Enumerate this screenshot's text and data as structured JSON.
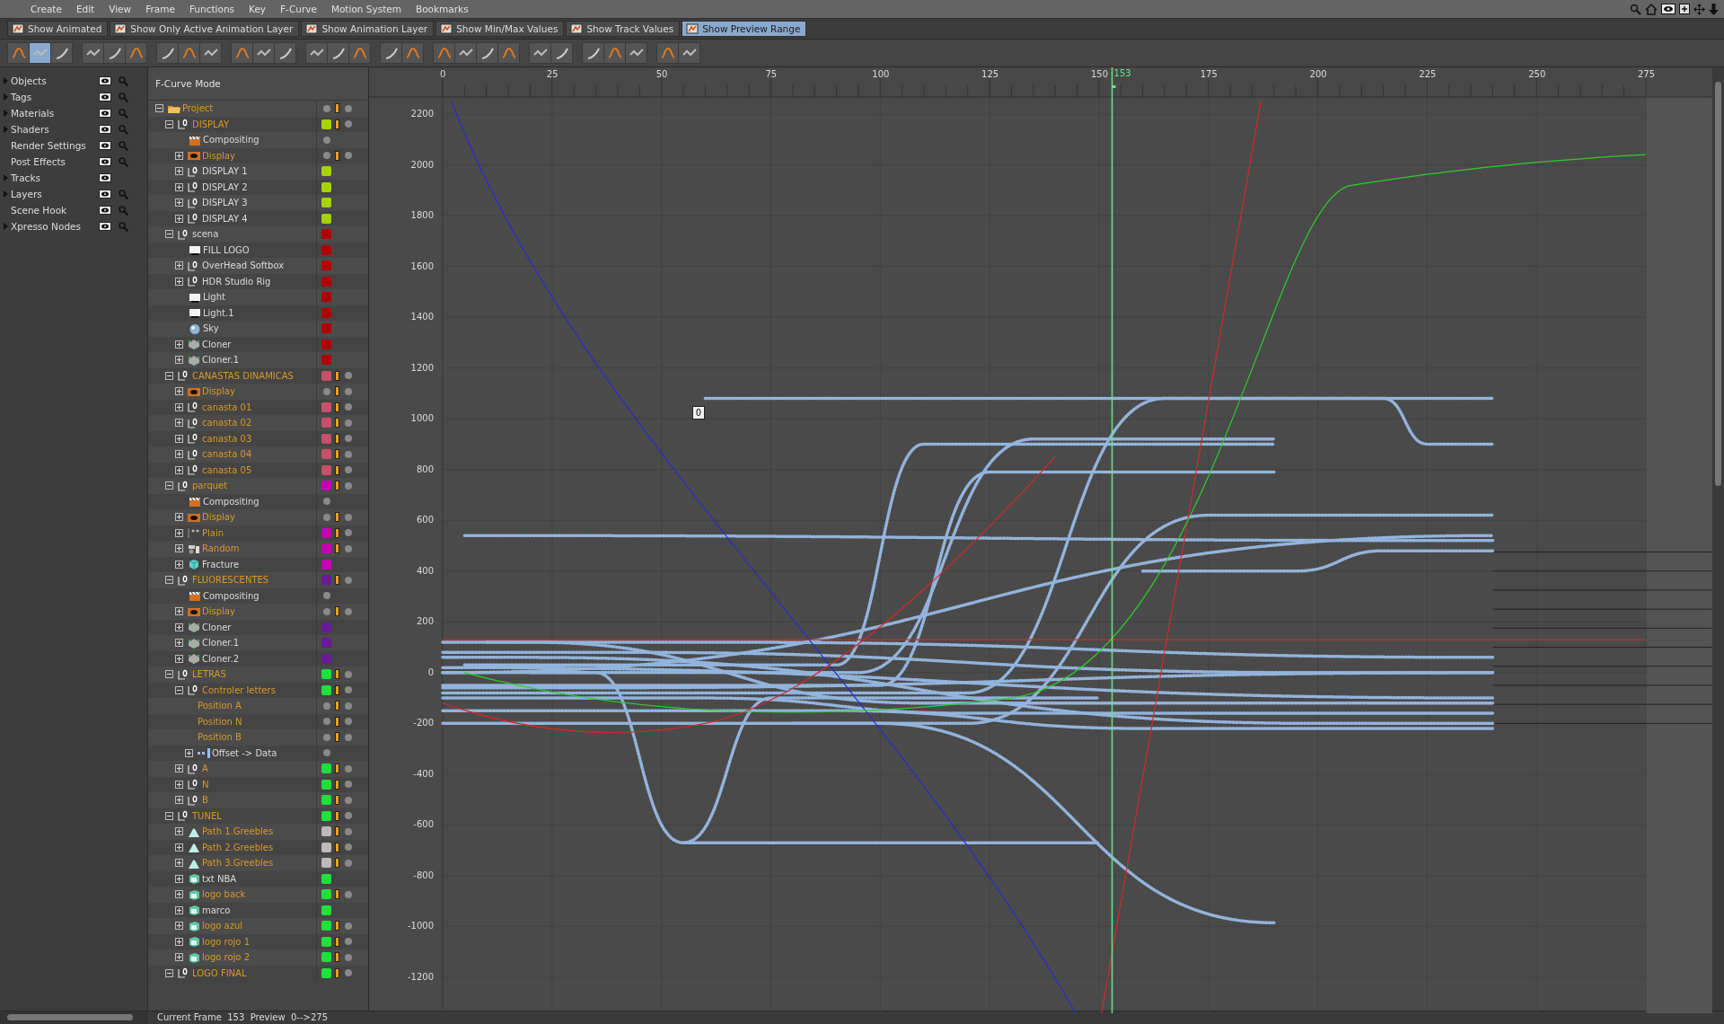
{
  "menu": [
    "Create",
    "Edit",
    "View",
    "Frame",
    "Functions",
    "Key",
    "F-Curve",
    "Motion System",
    "Bookmarks"
  ],
  "filters": [
    {
      "label": "Show Animated",
      "selected": false
    },
    {
      "label": "Show Only Active Animation Layer",
      "selected": false
    },
    {
      "label": "Show Animation Layer",
      "selected": false
    },
    {
      "label": "Show Min/Max Values",
      "selected": false
    },
    {
      "label": "Show Track Values",
      "selected": false
    },
    {
      "label": "Show Preview Range",
      "selected": true
    }
  ],
  "toolbar": [
    {
      "buttons": [
        {
          "selected": false
        },
        {
          "selected": true
        },
        {
          "selected": false
        }
      ]
    },
    {
      "buttons": [
        {
          "selected": false
        },
        {
          "selected": false
        },
        {
          "selected": false
        }
      ]
    },
    {
      "buttons": [
        {
          "selected": false
        },
        {
          "selected": false
        },
        {
          "selected": false
        }
      ]
    },
    {
      "buttons": [
        {
          "selected": false
        },
        {
          "selected": false
        },
        {
          "selected": false
        }
      ]
    },
    {
      "buttons": [
        {
          "selected": false
        },
        {
          "selected": false
        },
        {
          "selected": false
        }
      ]
    },
    {
      "buttons": [
        {
          "selected": false
        },
        {
          "selected": false
        }
      ]
    },
    {
      "buttons": [
        {
          "selected": false
        },
        {
          "selected": false
        },
        {
          "selected": false
        },
        {
          "selected": false
        }
      ]
    },
    {
      "buttons": [
        {
          "selected": false
        },
        {
          "selected": false
        }
      ]
    },
    {
      "buttons": [
        {
          "selected": false
        },
        {
          "selected": false
        },
        {
          "selected": false
        }
      ]
    },
    {
      "buttons": [
        {
          "selected": false
        },
        {
          "selected": false
        }
      ]
    }
  ],
  "sidebar": [
    {
      "label": "Objects",
      "expandable": true,
      "search": true
    },
    {
      "label": "Tags",
      "expandable": true,
      "search": true
    },
    {
      "label": "Materials",
      "expandable": true,
      "search": true
    },
    {
      "label": "Shaders",
      "expandable": true,
      "search": true
    },
    {
      "label": "Render Settings",
      "expandable": false,
      "search": true
    },
    {
      "label": "Post Effects",
      "expandable": false,
      "search": true
    },
    {
      "label": "Tracks",
      "expandable": true,
      "search": false
    },
    {
      "label": "Layers",
      "expandable": true,
      "search": true
    },
    {
      "label": "Scene Hook",
      "expandable": false,
      "search": true
    },
    {
      "label": "Xpresso Nodes",
      "expandable": true,
      "search": true
    }
  ],
  "tree_header": "F-Curve Mode",
  "tree": [
    {
      "label": "Project",
      "kind": "folder",
      "animated": true,
      "expanded": true,
      "children": [
        {
          "label": "DISPLAY",
          "kind": "null",
          "animated": true,
          "color": "#a8d400",
          "expanded": true,
          "children": [
            {
              "label": "Compositing",
              "kind": "compositing",
              "animated": false
            },
            {
              "label": "Display",
              "kind": "display",
              "animated": true,
              "expanded": false
            },
            {
              "label": "DISPLAY 1",
              "kind": "null",
              "animated": false,
              "color": "#a8d400",
              "expanded": false
            },
            {
              "label": "DISPLAY 2",
              "kind": "null",
              "animated": false,
              "color": "#a8d400",
              "expanded": false
            },
            {
              "label": "DISPLAY 3",
              "kind": "null",
              "animated": false,
              "color": "#a8d400",
              "expanded": false
            },
            {
              "label": "DISPLAY 4",
              "kind": "null",
              "animated": false,
              "color": "#a8d400",
              "expanded": false
            }
          ]
        },
        {
          "label": "scena",
          "kind": "null",
          "animated": false,
          "color": "#b00000",
          "expanded": true,
          "children": [
            {
              "label": "FILL LOGO",
              "kind": "light",
              "animated": false,
              "color": "#b00000"
            },
            {
              "label": "OverHead Softbox",
              "kind": "null",
              "animated": false,
              "color": "#b00000",
              "expanded": false
            },
            {
              "label": "HDR Studio Rig",
              "kind": "null",
              "animated": false,
              "color": "#b00000",
              "expanded": false
            },
            {
              "label": "Light",
              "kind": "light",
              "animated": false,
              "color": "#b00000"
            },
            {
              "label": "Light.1",
              "kind": "light",
              "animated": false,
              "color": "#b00000"
            },
            {
              "label": "Sky",
              "kind": "sky",
              "animated": false,
              "color": "#b00000"
            },
            {
              "label": "Cloner",
              "kind": "cloner",
              "animated": false,
              "color": "#b00000",
              "expanded": false
            },
            {
              "label": "Cloner.1",
              "kind": "cloner",
              "animated": false,
              "color": "#b00000",
              "expanded": false
            }
          ]
        },
        {
          "label": "CANASTAS DINAMICAS",
          "kind": "null",
          "animated": true,
          "color": "#c8506a",
          "expanded": true,
          "children": [
            {
              "label": "Display",
              "kind": "display",
              "animated": true,
              "expanded": false
            },
            {
              "label": "canasta 01",
              "kind": "null",
              "animated": true,
              "color": "#c8506a",
              "expanded": false
            },
            {
              "label": "canasta 02",
              "kind": "null",
              "animated": true,
              "color": "#c8506a",
              "expanded": false
            },
            {
              "label": "canasta 03",
              "kind": "null",
              "animated": true,
              "color": "#c8506a",
              "expanded": false
            },
            {
              "label": "canasta 04",
              "kind": "null",
              "animated": true,
              "color": "#c8506a",
              "expanded": false
            },
            {
              "label": "canasta 05",
              "kind": "null",
              "animated": true,
              "color": "#c8506a",
              "expanded": false
            }
          ]
        },
        {
          "label": "parquet",
          "kind": "null",
          "animated": true,
          "color": "#c800b4",
          "expanded": true,
          "children": [
            {
              "label": "Compositing",
              "kind": "compositing",
              "animated": false
            },
            {
              "label": "Display",
              "kind": "display",
              "animated": true,
              "expanded": false
            },
            {
              "label": "Plain",
              "kind": "plain",
              "animated": true,
              "color": "#c800b4",
              "expanded": false
            },
            {
              "label": "Random",
              "kind": "random",
              "animated": true,
              "color": "#c800b4",
              "expanded": false
            },
            {
              "label": "Fracture",
              "kind": "fracture",
              "animated": false,
              "color": "#c800b4",
              "expanded": false
            }
          ]
        },
        {
          "label": "FLUORESCENTES",
          "kind": "null",
          "animated": true,
          "color": "#6a1a9a",
          "expanded": true,
          "children": [
            {
              "label": "Compositing",
              "kind": "compositing",
              "animated": false
            },
            {
              "label": "Display",
              "kind": "display",
              "animated": true,
              "expanded": false
            },
            {
              "label": "Cloner",
              "kind": "cloner",
              "animated": false,
              "color": "#6a1a9a",
              "expanded": false
            },
            {
              "label": "Cloner.1",
              "kind": "cloner",
              "animated": false,
              "color": "#6a1a9a",
              "expanded": false
            },
            {
              "label": "Cloner.2",
              "kind": "cloner",
              "animated": false,
              "color": "#6a1a9a",
              "expanded": false
            }
          ]
        },
        {
          "label": "LETRAS",
          "kind": "null",
          "animated": true,
          "color": "#1ee23c",
          "expanded": true,
          "children": [
            {
              "label": "Controler letters",
              "kind": "null",
              "animated": true,
              "color": "#1ee23c",
              "expanded": true,
              "children": [
                {
                  "label": "Position A",
                  "kind": "track",
                  "animated": true
                },
                {
                  "label": "Position N",
                  "kind": "track",
                  "animated": true
                },
                {
                  "label": "Position B",
                  "kind": "track",
                  "animated": true
                },
                {
                  "label": "Offset -> Data",
                  "kind": "xpresso",
                  "animated": false,
                  "expanded": false
                }
              ]
            },
            {
              "label": "A",
              "kind": "null",
              "animated": true,
              "color": "#1ee23c",
              "expanded": false
            },
            {
              "label": "N",
              "kind": "null",
              "animated": true,
              "color": "#1ee23c",
              "expanded": false
            },
            {
              "label": "B",
              "kind": "null",
              "animated": true,
              "color": "#1ee23c",
              "expanded": false
            }
          ]
        },
        {
          "label": "TUNEL",
          "kind": "null",
          "animated": true,
          "color": "#1ee23c",
          "expanded": true,
          "children": [
            {
              "label": "Path 1.Greebles",
              "kind": "path",
              "animated": true,
              "color": "#c0b8b8",
              "expanded": false
            },
            {
              "label": "Path 2.Greebles",
              "kind": "path",
              "animated": true,
              "color": "#c0b8b8",
              "expanded": false
            },
            {
              "label": "Path 3.Greebles",
              "kind": "path",
              "animated": true,
              "color": "#c0b8b8",
              "expanded": false
            },
            {
              "label": "txt NBA",
              "kind": "text",
              "animated": false,
              "color": "#1ee23c",
              "expanded": false
            },
            {
              "label": "logo back",
              "kind": "text",
              "animated": true,
              "color": "#1ee23c",
              "expanded": false
            },
            {
              "label": "marco",
              "kind": "text",
              "animated": false,
              "color": "#1ee23c",
              "expanded": false
            },
            {
              "label": "logo azul",
              "kind": "text",
              "animated": true,
              "color": "#1ee23c",
              "expanded": false
            },
            {
              "label": "logo rojo 1",
              "kind": "text",
              "animated": true,
              "color": "#1ee23c",
              "expanded": false
            },
            {
              "label": "logo rojo 2",
              "kind": "text",
              "animated": true,
              "color": "#1ee23c",
              "expanded": false
            }
          ]
        },
        {
          "label": "LOGO FINAL",
          "kind": "null",
          "animated": true,
          "color": "#1ee23c",
          "expanded": true
        }
      ]
    }
  ],
  "graph": {
    "frame_ticks": [
      "0",
      "25",
      "50",
      "75",
      "100",
      "125",
      "150",
      "175",
      "200",
      "225",
      "250",
      "275"
    ],
    "current_frame": "153",
    "value_ticks": [
      "2200",
      "2000",
      "1800",
      "1600",
      "1400",
      "1200",
      "1000",
      "800",
      "600",
      "400",
      "200",
      "0",
      "-200",
      "-400",
      "-600",
      "-800",
      "-1000",
      "-1200"
    ],
    "key_value": "0"
  },
  "status": "Current Frame  153  Preview  0-->275"
}
